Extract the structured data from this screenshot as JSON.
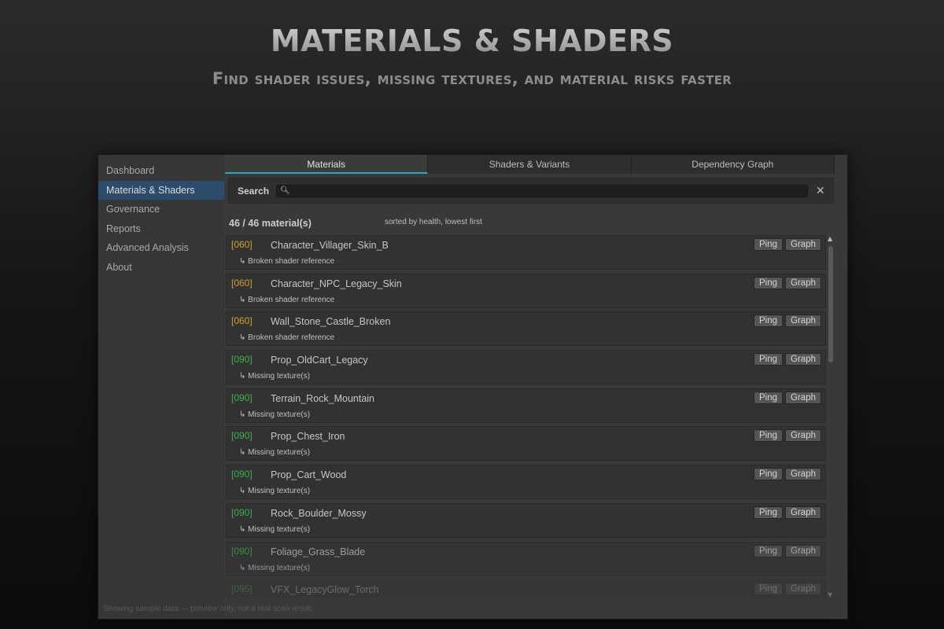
{
  "hero": {
    "title": "MATERIALS & SHADERS",
    "subtitle": "Find shader issues, missing textures, and material risks faster"
  },
  "sidebar": {
    "items": [
      {
        "label": "Dashboard"
      },
      {
        "label": "Materials & Shaders"
      },
      {
        "label": "Governance"
      },
      {
        "label": "Reports"
      },
      {
        "label": "Advanced Analysis"
      },
      {
        "label": "About"
      }
    ],
    "active_index": 1
  },
  "tabs": [
    {
      "label": "Materials"
    },
    {
      "label": "Shaders & Variants"
    },
    {
      "label": "Dependency Graph"
    }
  ],
  "search": {
    "label": "Search",
    "value": "",
    "clear_icon": "✕"
  },
  "summary": {
    "count": "46 / 46 material(s)",
    "sort_note": "sorted by health, lowest first"
  },
  "rows": [
    {
      "score": "[060]",
      "name": "Character_Villager_Skin_B",
      "issue": "↳ Broken shader reference",
      "ping": "Ping",
      "graph": "Graph"
    },
    {
      "score": "[060]",
      "name": "Character_NPC_Legacy_Skin",
      "issue": "↳ Broken shader reference",
      "ping": "Ping",
      "graph": "Graph"
    },
    {
      "score": "[060]",
      "name": "Wall_Stone_Castle_Broken",
      "issue": "↳ Broken shader reference",
      "ping": "Ping",
      "graph": "Graph"
    },
    {
      "score": "[090]",
      "name": "Prop_OldCart_Legacy",
      "issue": "↳ Missing texture(s)",
      "ping": "Ping",
      "graph": "Graph"
    },
    {
      "score": "[090]",
      "name": "Terrain_Rock_Mountain",
      "issue": "↳ Missing texture(s)",
      "ping": "Ping",
      "graph": "Graph"
    },
    {
      "score": "[090]",
      "name": "Prop_Chest_Iron",
      "issue": "↳ Missing texture(s)",
      "ping": "Ping",
      "graph": "Graph"
    },
    {
      "score": "[090]",
      "name": "Prop_Cart_Wood",
      "issue": "↳ Missing texture(s)",
      "ping": "Ping",
      "graph": "Graph"
    },
    {
      "score": "[090]",
      "name": "Rock_Boulder_Mossy",
      "issue": "↳ Missing texture(s)",
      "ping": "Ping",
      "graph": "Graph"
    },
    {
      "score": "[090]",
      "name": "Foliage_Grass_Blade",
      "issue": "↳ Missing texture(s)",
      "ping": "Ping",
      "graph": "Graph"
    },
    {
      "score": "[095]",
      "name": "VFX_LegacyGlow_Torch",
      "issue": "",
      "ping": "Ping",
      "graph": "Graph"
    }
  ],
  "footer": {
    "note": "Showing sample data — preview only, not a real scan result."
  },
  "colors": {
    "score_warn": "#d2a028",
    "score_ok": "#39b24a",
    "tab_accent": "#2aa3c8",
    "sidebar_active": "#2c4c6b"
  }
}
